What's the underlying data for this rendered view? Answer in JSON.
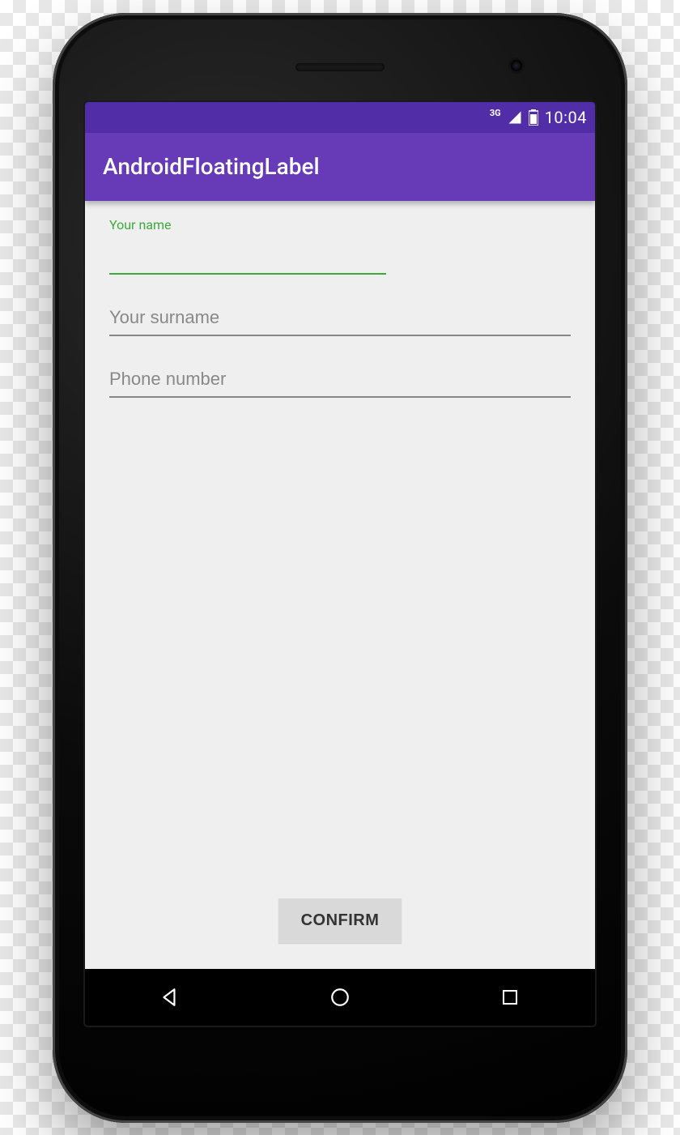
{
  "statusbar": {
    "network_label": "3G",
    "clock": "10:04"
  },
  "appbar": {
    "title": "AndroidFloatingLabel"
  },
  "form": {
    "name": {
      "floating_label": "Your name",
      "value": ""
    },
    "surname": {
      "placeholder": "Your surname",
      "value": ""
    },
    "phone": {
      "placeholder": "Phone number",
      "value": ""
    },
    "confirm_label": "CONFIRM"
  },
  "colors": {
    "primary": "#673ab7",
    "primary_dark": "#512da8",
    "accent_green": "#3bab3b"
  }
}
